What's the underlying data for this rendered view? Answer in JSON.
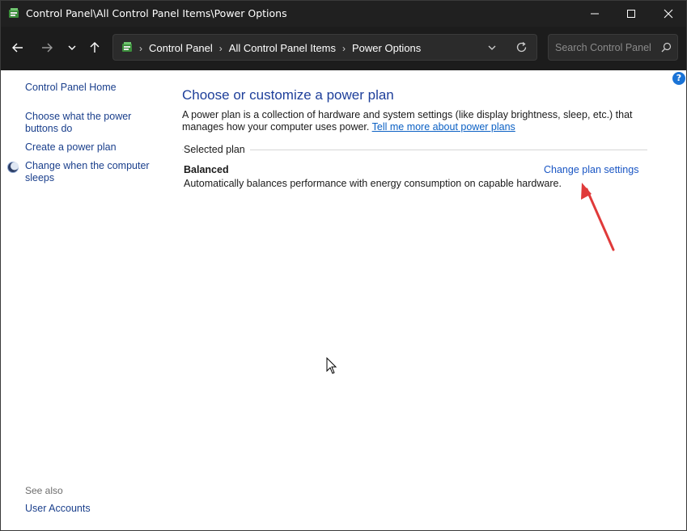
{
  "window": {
    "title": "Control Panel\\All Control Panel Items\\Power Options"
  },
  "addressbar": {
    "crumbs": [
      "Control Panel",
      "All Control Panel Items",
      "Power Options"
    ]
  },
  "search": {
    "placeholder": "Search Control Panel"
  },
  "sidebar": {
    "home": "Control Panel Home",
    "tasks": [
      {
        "label": "Choose what the power buttons do"
      },
      {
        "label": "Create a power plan"
      },
      {
        "label": "Change when the computer sleeps"
      }
    ],
    "see_also_label": "See also",
    "see_also_items": [
      {
        "label": "User Accounts"
      }
    ]
  },
  "main": {
    "title": "Choose or customize a power plan",
    "description": "A power plan is a collection of hardware and system settings (like display brightness, sleep, etc.) that manages how your computer uses power.",
    "learn_more_link": "Tell me more about power plans",
    "selected_plan_label": "Selected plan",
    "plan": {
      "name": "Balanced",
      "description": "Automatically balances performance with energy consumption on capable hardware.",
      "change_link": "Change plan settings"
    }
  },
  "help": {
    "label": "?"
  },
  "colors": {
    "titlebar_bg": "#202020",
    "navbar_bg": "#1c1c1c",
    "link": "#1a56c4",
    "heading": "#1e3f9a",
    "annotation_arrow": "#e03a3a"
  }
}
